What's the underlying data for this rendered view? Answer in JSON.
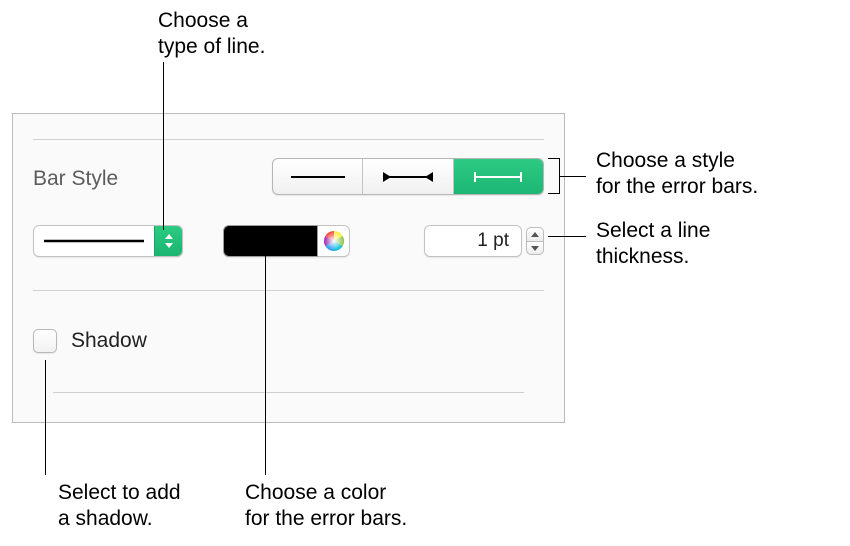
{
  "panel": {
    "heading": "Bar Style",
    "segmented": {
      "options": [
        "line",
        "bowtie",
        "capped"
      ],
      "selected_index": 2
    },
    "line_type": {
      "value": "solid"
    },
    "color": {
      "value": "#000000"
    },
    "thickness": {
      "value": "1 pt"
    },
    "shadow": {
      "label": "Shadow",
      "checked": false
    }
  },
  "callouts": {
    "line_type": "Choose a\ntype of line.",
    "bar_style": "Choose a style\nfor the error bars.",
    "thickness": "Select a line\nthickness.",
    "shadow": "Select to add\na shadow.",
    "color": "Choose a color\nfor the error bars."
  }
}
